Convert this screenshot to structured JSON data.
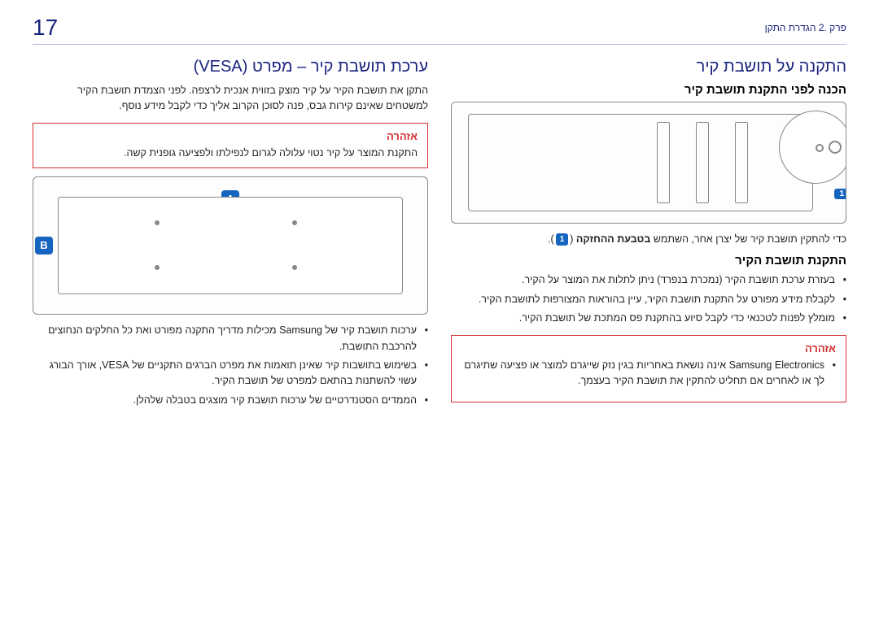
{
  "page": {
    "number": "17",
    "chapter": "פרק .2 הגדרת התקן"
  },
  "right": {
    "h2": "התקנה על תושבת קיר",
    "h3_prep": "הכנה לפני התקנת תושבת קיר",
    "callout1": "1",
    "prep_text_a": "כדי להתקין תושבת קיר של יצרן אחר, השתמש ",
    "prep_text_bold": "בטבעת ההחזקה",
    "prep_text_b": " (",
    "prep_text_c": ").",
    "h3_install": "התקנת תושבת הקיר",
    "bullets": [
      "בעזרת ערכת תושבת הקיר (נמכרת בנפרד) ניתן לתלות את המוצר על הקיר.",
      "לקבלת מידע מפורט על התקנת תושבת הקיר, עיין בהוראות המצורפות לתושבת הקיר.",
      "מומלץ לפנות לטכנאי כדי לקבל סיוע בהתקנת פס המתכת של תושבת הקיר."
    ],
    "warning": {
      "title": "אזהרה",
      "items": [
        "Samsung Electronics אינה נושאת באחריות בגין נזק שייגרם למוצר או פציעה שתיגרם לך או לאחרים אם תחליט להתקין את תושבת הקיר בעצמך."
      ]
    }
  },
  "left": {
    "h2": "ערכת תושבת קיר – מפרט (VESA)",
    "intro": "התקן את תושבת הקיר על קיר מוצק בזווית אנכית לרצפה. לפני הצמדת תושבת הקיר למשטחים שאינם קירות גבס, פנה לסוכן הקרוב אליך כדי לקבל מידע נוסף.",
    "warning": {
      "title": "אזהרה",
      "text": "התקנת המוצר על קיר נטוי עלולה לגרום לנפילתו ולפציעה גופנית קשה."
    },
    "markerA": "A",
    "markerB": "B",
    "bullets": [
      "ערכות תושבת קיר של Samsung מכילות מדריך התקנה מפורט ואת כל החלקים הנחוצים להרכבת התושבת.",
      "בשימוש בתושבות קיר שאינן תואמות את מפרט הברגים התקניים של VESA, אורך הבורג עשוי להשתנות בהתאם למפרט של תושבת הקיר.",
      "הממדים הסטנדרטיים של ערכות תושבת קיר מוצגים בטבלה שלהלן."
    ]
  }
}
